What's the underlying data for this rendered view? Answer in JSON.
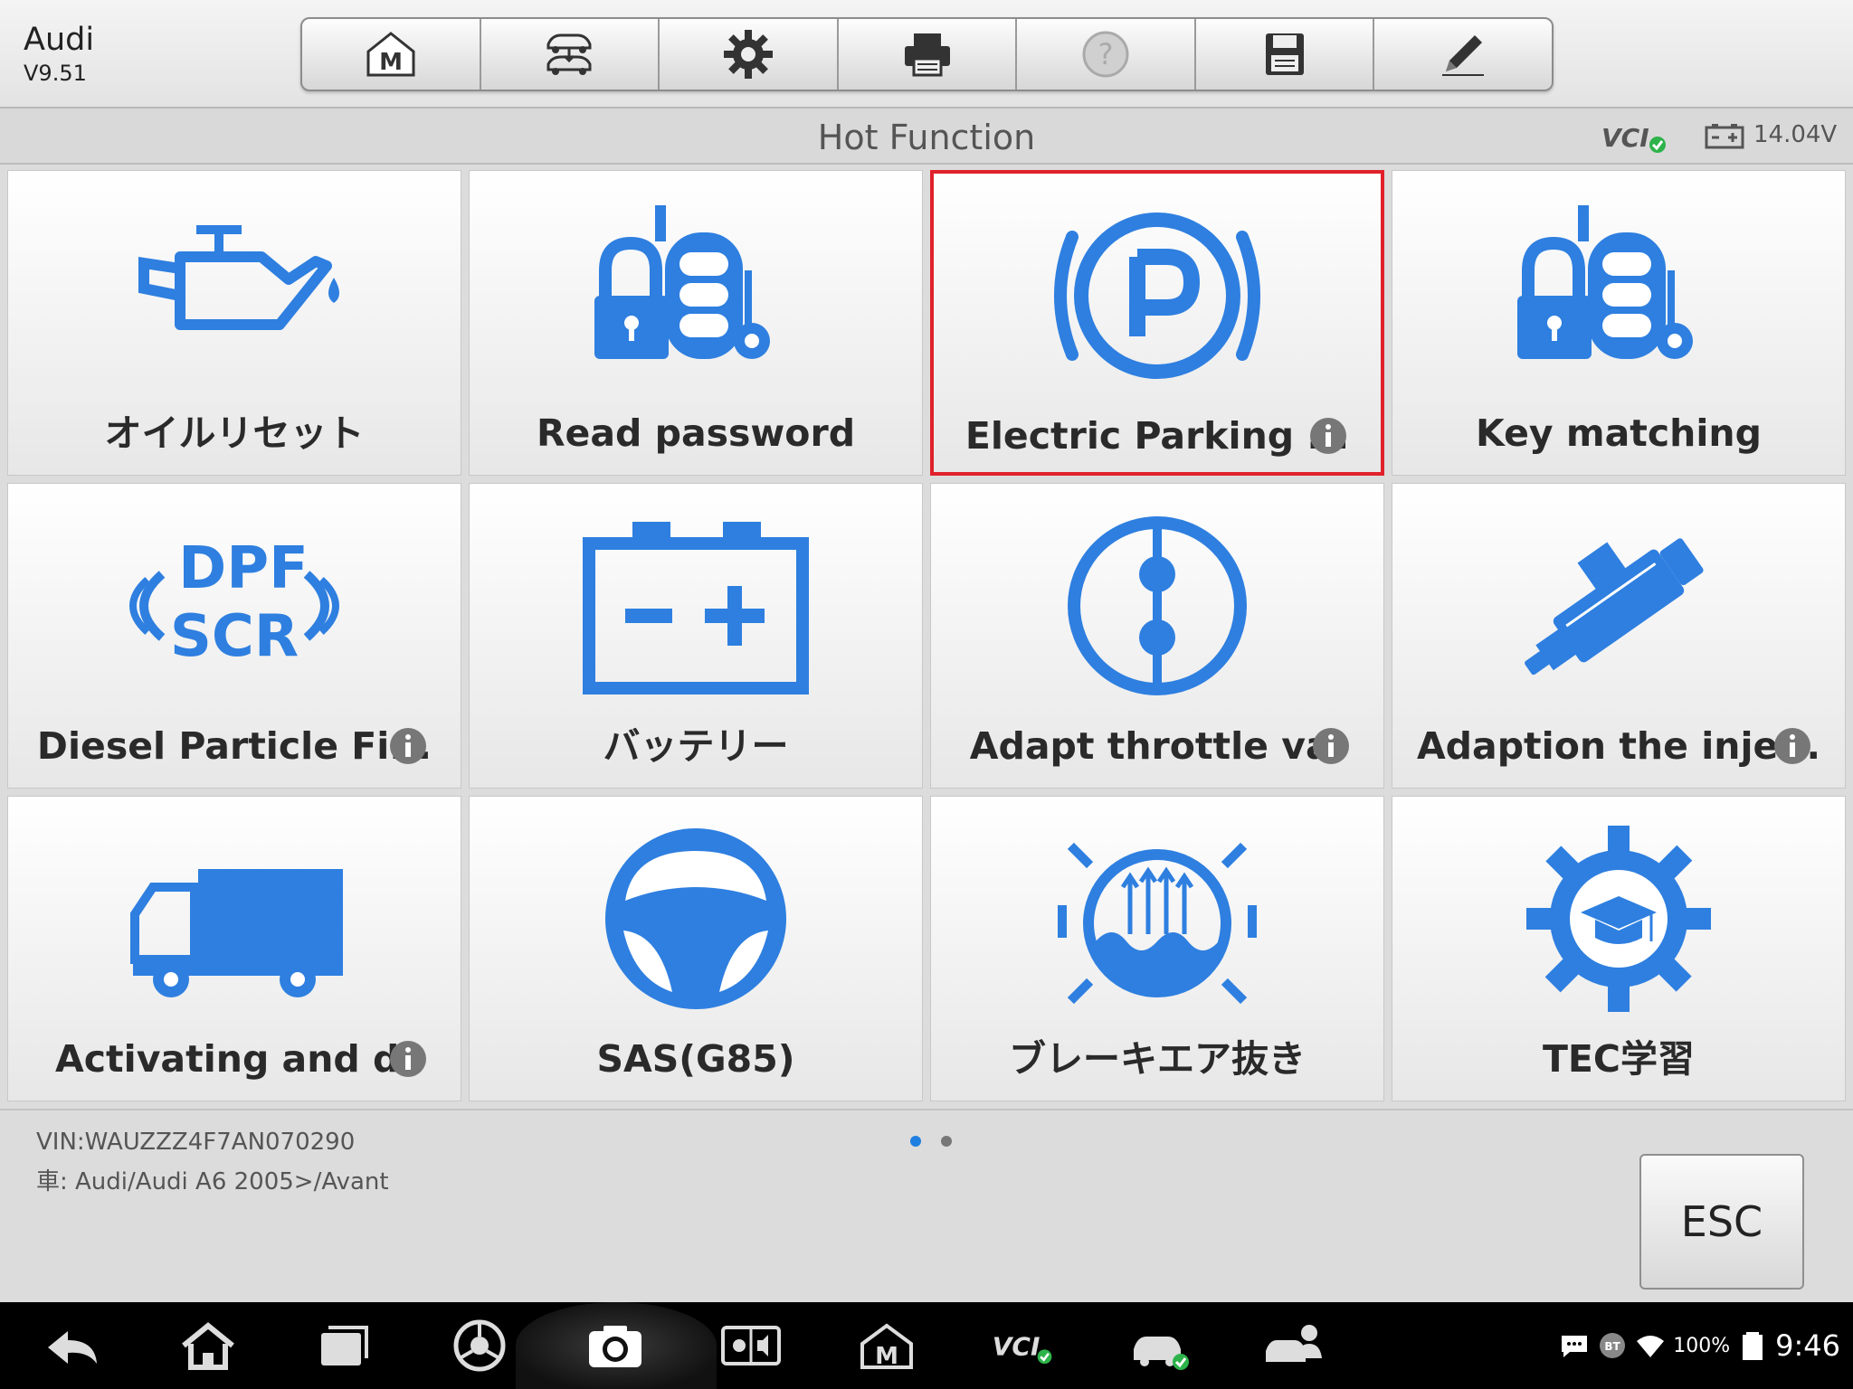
{
  "header": {
    "brand": "Audi",
    "version": "V9.51",
    "toolbar": [
      {
        "icon": "home-m-icon"
      },
      {
        "icon": "vehicle-swap-icon"
      },
      {
        "icon": "gear-icon"
      },
      {
        "icon": "printer-icon"
      },
      {
        "icon": "help-icon",
        "disabled": true
      },
      {
        "icon": "save-icon"
      },
      {
        "icon": "pencil-icon"
      }
    ]
  },
  "titlebar": {
    "title": "Hot Function",
    "voltage": "14.04V"
  },
  "tiles": [
    {
      "label": "オイルリセット",
      "icon": "oil-can-icon",
      "info": false,
      "selected": false
    },
    {
      "label": "Read password",
      "icon": "key-lock-icon",
      "info": false,
      "selected": false
    },
    {
      "label": "Electric Parking ...",
      "icon": "parking-brake-icon",
      "info": true,
      "selected": true
    },
    {
      "label": "Key matching",
      "icon": "key-lock-icon",
      "info": false,
      "selected": false
    },
    {
      "label": "Diesel Particle Fi...",
      "icon": "dpf-scr-icon",
      "info": true,
      "selected": false
    },
    {
      "label": "バッテリー",
      "icon": "battery-icon",
      "info": false,
      "selected": false
    },
    {
      "label": "Adapt throttle va.",
      "icon": "throttle-icon",
      "info": true,
      "selected": false
    },
    {
      "label": "Adaption the inje...",
      "icon": "injector-icon",
      "info": true,
      "selected": false
    },
    {
      "label": "Activating and d.",
      "icon": "truck-icon",
      "info": true,
      "selected": false
    },
    {
      "label": "SAS(G85)",
      "icon": "steering-wheel-icon",
      "info": false,
      "selected": false
    },
    {
      "label": "ブレーキエア抜き",
      "icon": "brake-bleed-icon",
      "info": false,
      "selected": false
    },
    {
      "label": "TEC学習",
      "icon": "tec-gear-icon",
      "info": false,
      "selected": false
    }
  ],
  "icon_text": {
    "dpf": "DPF",
    "scr": "SCR",
    "vcl": "VCI"
  },
  "info": {
    "vin": "VIN:WAUZZZ4F7AN070290",
    "vehicle": "車: Audi/Audi A6 2005>/Avant"
  },
  "pager": {
    "pages": 2,
    "current": 0
  },
  "esc_label": "ESC",
  "statusbar": {
    "battery_pct": "100%",
    "time": "9:46",
    "bt": "BT"
  },
  "colors": {
    "accent_blue": "#2e7fe0",
    "selected_border": "#e0212b"
  }
}
